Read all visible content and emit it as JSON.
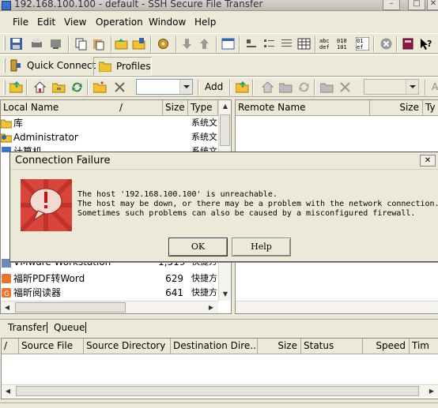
{
  "window": {
    "title": "192.168.100.100 - default - SSH Secure File Transfer"
  },
  "menu": [
    "File",
    "Edit",
    "View",
    "Operation",
    "Window",
    "Help"
  ],
  "toolbar2": {
    "quick_connect": "Quick Connect",
    "profiles": "Profiles"
  },
  "toolbar3": {
    "add_label": "Add",
    "add_label_right": "A"
  },
  "local": {
    "headers": {
      "name": "Local Name",
      "sort": "/",
      "size": "Size",
      "type": "Type"
    },
    "rows_top": [
      {
        "name": "库",
        "size": "",
        "type": "系统文"
      },
      {
        "name": "Administrator",
        "size": "",
        "type": "系统文"
      },
      {
        "name": "计算机",
        "size": "",
        "type": "系统文"
      }
    ],
    "rows_bottom": [
      {
        "name": "VMware Workstation",
        "size": "1,519",
        "type": "快捷方"
      },
      {
        "name": "福昕PDF转Word",
        "size": "629",
        "type": "快捷方"
      },
      {
        "name": "福昕阅读器",
        "size": "641",
        "type": "快捷方"
      }
    ]
  },
  "remote": {
    "headers": {
      "name": "Remote Name",
      "size": "Size",
      "type": "Ty"
    }
  },
  "dialog": {
    "title": "Connection Failure",
    "lines": [
      "The host '192.168.100.100' is unreachable.",
      "The host may be down, or there may be a problem with the network connection.",
      "Sometimes such problems can also be caused by a misconfigured firewall."
    ],
    "ok": "OK",
    "help": "Help"
  },
  "transfer": {
    "tabs": [
      "Transfer",
      "Queue"
    ],
    "headers": {
      "sort": "/",
      "source_file": "Source File",
      "source_dir": "Source Directory",
      "dest_dir": "Destination Dire...",
      "size": "Size",
      "status": "Status",
      "speed": "Speed",
      "time": "Tim"
    }
  },
  "colors": {
    "dialog_icon": "#c9302c",
    "folder": "#f1c232",
    "window_bg": "#ece9d8"
  }
}
